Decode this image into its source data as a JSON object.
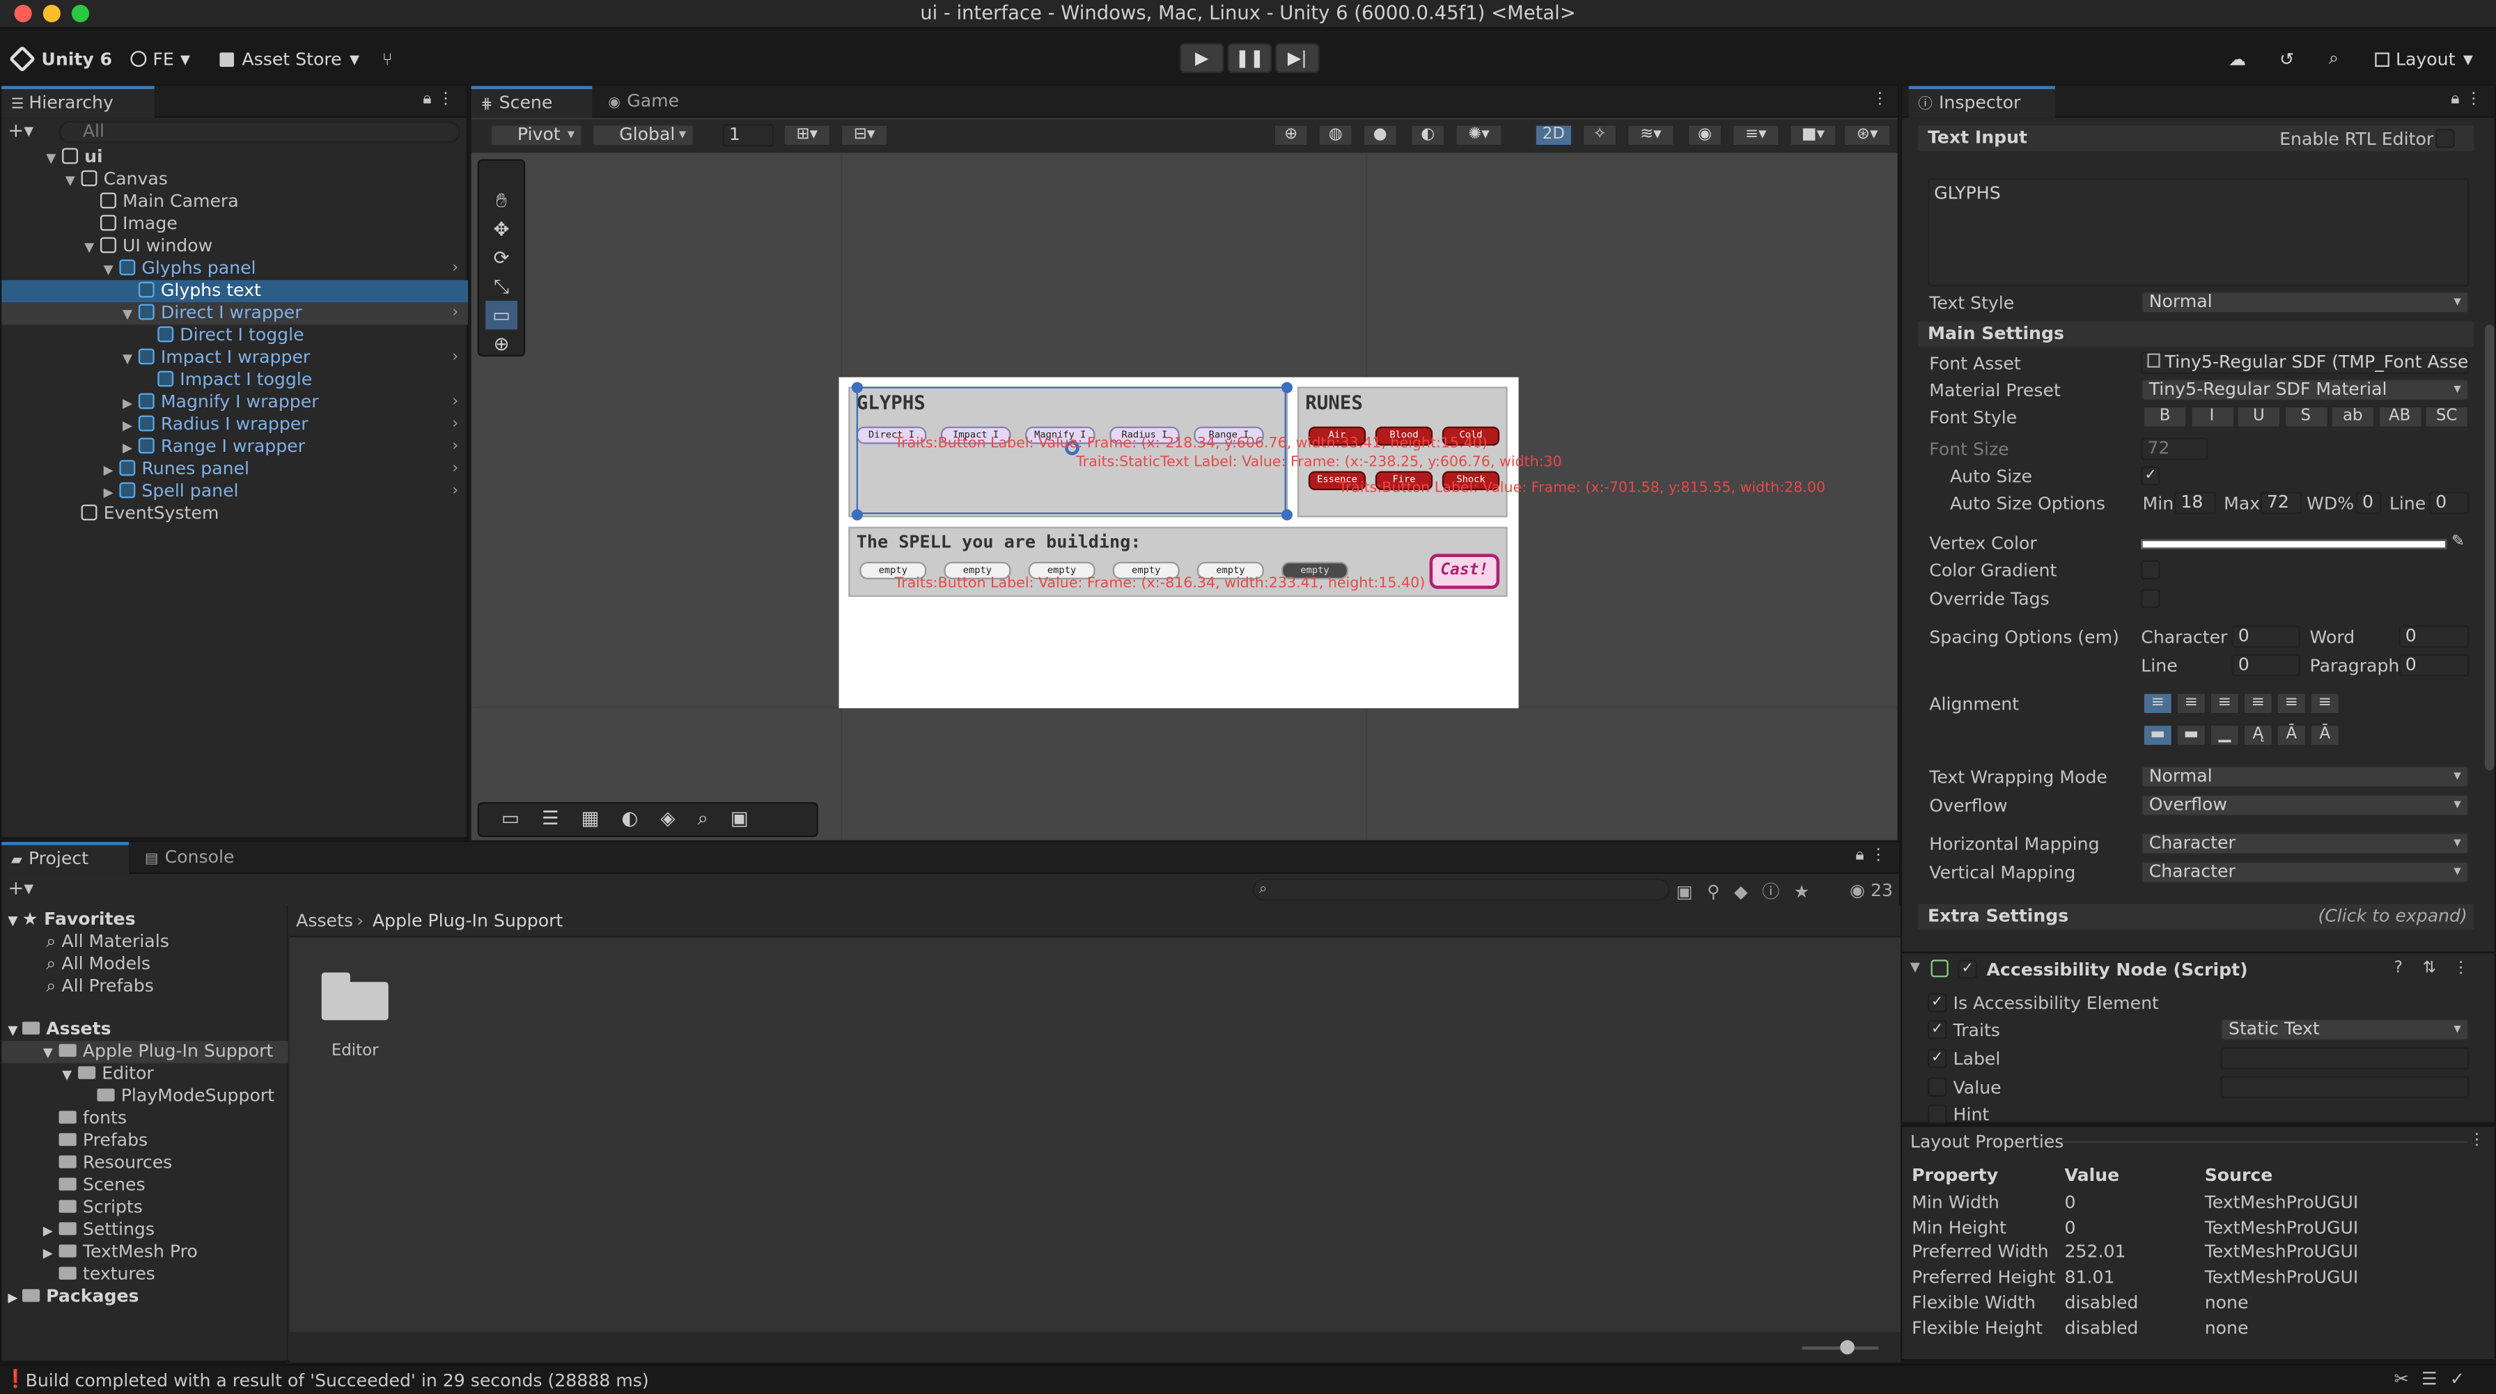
{
  "window": {
    "title": "ui - interface - Windows, Mac, Linux - Unity 6 (6000.0.45f1) <Metal>"
  },
  "toolbar": {
    "brand": "Unity 6",
    "account": "FE",
    "asset_store": "Asset Store",
    "layout": "Layout"
  },
  "hierarchy": {
    "tab": "Hierarchy",
    "search_placeholder": "All",
    "items": [
      {
        "label": "ui",
        "indent": 0
      },
      {
        "label": "Canvas",
        "indent": 1
      },
      {
        "label": "Main Camera",
        "indent": 2
      },
      {
        "label": "Image",
        "indent": 2
      },
      {
        "label": "UI window",
        "indent": 2
      },
      {
        "label": "Glyphs panel",
        "indent": 3
      },
      {
        "label": "Glyphs text",
        "indent": 4
      },
      {
        "label": "Direct I wrapper",
        "indent": 4
      },
      {
        "label": "Direct I toggle",
        "indent": 5
      },
      {
        "label": "Impact I wrapper",
        "indent": 4
      },
      {
        "label": "Impact I toggle",
        "indent": 5
      },
      {
        "label": "Magnify I wrapper",
        "indent": 4
      },
      {
        "label": "Radius I wrapper",
        "indent": 4
      },
      {
        "label": "Range I wrapper",
        "indent": 4
      },
      {
        "label": "Runes panel",
        "indent": 3
      },
      {
        "label": "Spell panel",
        "indent": 3
      },
      {
        "label": "EventSystem",
        "indent": 1
      }
    ]
  },
  "scene": {
    "tabs": [
      "Scene",
      "Game"
    ],
    "pivot": "Pivot",
    "global": "Global",
    "snap_value": "1",
    "mode_2d": "2D",
    "game_ui": {
      "glyphs_title": "GLYPHS",
      "glyph_chips": [
        "Direct I",
        "Impact I",
        "Magnify I",
        "Radius I",
        "Range I"
      ],
      "runes_title": "RUNES",
      "rune_chips": [
        "Air",
        "Blood",
        "Cold",
        "Essence",
        "Fire",
        "Shock"
      ],
      "spell_title": "The SPELL you are building:",
      "spell_slots": [
        "empty",
        "empty",
        "empty",
        "empty",
        "empty",
        "empty"
      ],
      "cast": "Cast!",
      "overlay_text_1": "Traits:Button Label: Value: Frame: (x:-218.34, y:606.76, width:33.41, height:15.40)",
      "overlay_text_2": "Traits:StaticText Label: Value: Frame: (x:-238.25, y:606.76, width:30",
      "overlay_text_3": "Traits:Button Label: Value: Frame: (x:-701.58, y:815.55, width:28.00",
      "overlay_text_4": "Traits:Button Label: Value: Frame: (x:-816.34, width:233.41, height:15.40)"
    }
  },
  "inspector": {
    "tab": "Inspector",
    "text_input_header": "Text Input",
    "enable_rtl": "Enable RTL Editor",
    "text_value": "GLYPHS",
    "text_style_label": "Text Style",
    "text_style_value": "Normal",
    "main_settings": "Main Settings",
    "font_asset_label": "Font Asset",
    "font_asset_value": "Tiny5-Regular SDF (TMP_Font Asse",
    "material_preset_label": "Material Preset",
    "material_preset_value": "Tiny5-Regular SDF Material",
    "font_style_label": "Font Style",
    "font_style_buttons": [
      "B",
      "I",
      "U",
      "S",
      "ab",
      "AB",
      "SC"
    ],
    "font_size_label": "Font Size",
    "font_size_value": "72",
    "auto_size_label": "Auto Size",
    "auto_size_options_label": "Auto Size Options",
    "min_label": "Min",
    "min_value": "18",
    "max_label": "Max",
    "max_value": "72",
    "wd_label": "WD%",
    "wd_value": "0",
    "line_label": "Line",
    "line_value": "0",
    "vertex_color_label": "Vertex Color",
    "color_gradient_label": "Color Gradient",
    "override_tags_label": "Override Tags",
    "spacing_label": "Spacing Options (em)",
    "character_label": "Character",
    "character_value": "0",
    "word_label": "Word",
    "word_value": "0",
    "line2_label": "Line",
    "line2_value": "0",
    "paragraph_label": "Paragraph",
    "paragraph_value": "0",
    "alignment_label": "Alignment",
    "wrapping_label": "Text Wrapping Mode",
    "wrapping_value": "Normal",
    "overflow_label": "Overflow",
    "overflow_value": "Overflow",
    "hmap_label": "Horizontal Mapping",
    "hmap_value": "Character",
    "vmap_label": "Vertical Mapping",
    "vmap_value": "Character",
    "extra_settings": "Extra Settings",
    "click_expand": "(Click to expand)",
    "component_title": "Accessibility Node (Script)",
    "is_access_label": "Is Accessibility Element",
    "traits_label": "Traits",
    "traits_value": "Static Text",
    "label_label": "Label",
    "value_label": "Value",
    "hint_label": "Hint",
    "layout_props": "Layout Properties",
    "lp_headers": [
      "Property",
      "Value",
      "Source"
    ],
    "lp_rows": [
      {
        "p": "Min Width",
        "v": "0",
        "s": "TextMeshProUGUI"
      },
      {
        "p": "Min Height",
        "v": "0",
        "s": "TextMeshProUGUI"
      },
      {
        "p": "Preferred Width",
        "v": "252.01",
        "s": "TextMeshProUGUI"
      },
      {
        "p": "Preferred Height",
        "v": "81.01",
        "s": "TextMeshProUGUI"
      },
      {
        "p": "Flexible Width",
        "v": "disabled",
        "s": "none"
      },
      {
        "p": "Flexible Height",
        "v": "disabled",
        "s": "none"
      }
    ]
  },
  "project": {
    "tabs": [
      "Project",
      "Console"
    ],
    "favorites": "Favorites",
    "fav_items": [
      "All Materials",
      "All Models",
      "All Prefabs"
    ],
    "assets": "Assets",
    "asset_tree": [
      {
        "label": "Apple Plug-In Support",
        "indent": 1
      },
      {
        "label": "Editor",
        "indent": 2
      },
      {
        "label": "PlayModeSupport",
        "indent": 3
      },
      {
        "label": "fonts",
        "indent": 1
      },
      {
        "label": "Prefabs",
        "indent": 1
      },
      {
        "label": "Resources",
        "indent": 1
      },
      {
        "label": "Scenes",
        "indent": 1
      },
      {
        "label": "Scripts",
        "indent": 1
      },
      {
        "label": "Settings",
        "indent": 1
      },
      {
        "label": "TextMesh Pro",
        "indent": 1
      },
      {
        "label": "textures",
        "indent": 1
      }
    ],
    "packages": "Packages",
    "breadcrumb_root": "Assets",
    "breadcrumb_current": "Apple Plug-In Support",
    "folder_name": "Editor",
    "count": "23"
  },
  "status": {
    "message": "Build completed with a result of 'Succeeded' in 29 seconds (28888 ms)"
  },
  "colors": {
    "accent": "#3a79bb",
    "selection": "#2c5d87",
    "overlay_red": "#e84848"
  }
}
